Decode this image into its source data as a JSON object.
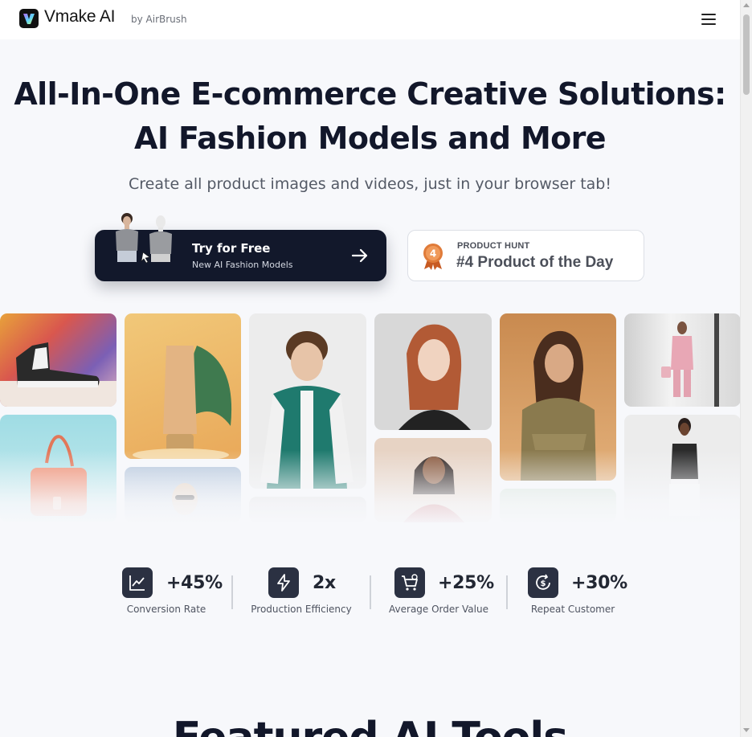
{
  "header": {
    "brand": "Vmake AI",
    "brand_suffix": "by AirBrush",
    "menu_icon": "hamburger-menu-icon"
  },
  "hero": {
    "title_line1": "All-In-One E-commerce Creative Solutions:",
    "title_line2": "AI Fashion Models and More",
    "subtitle": "Create all product images and videos, just in your browser tab!"
  },
  "cta": {
    "label": "Try for Free",
    "sublabel": "New AI Fashion Models",
    "icon": "arrow-right-icon"
  },
  "product_hunt": {
    "label": "PRODUCT HUNT",
    "rank_text": "#4 Product of the Day",
    "medal_number": "4",
    "icon": "medal-icon"
  },
  "gallery": {
    "items": [
      "sneaker",
      "skincare-tube",
      "model-varsity-jacket",
      "model-red-hair",
      "model-knit-cardigan",
      "model-pink-suit",
      "handbag",
      "model-sunglasses",
      "model-tank-top",
      "model-red-top"
    ]
  },
  "stats": [
    {
      "value": "+45%",
      "label": "Conversion Rate",
      "icon": "chart-line-icon"
    },
    {
      "value": "2x",
      "label": "Production Efficiency",
      "icon": "lightning-icon"
    },
    {
      "value": "+25%",
      "label": "Average Order Value",
      "icon": "cart-icon"
    },
    {
      "value": "+30%",
      "label": "Repeat Customer",
      "icon": "dollar-refresh-icon"
    }
  ],
  "section": {
    "title": "Featured AI Tools"
  },
  "colors": {
    "primary_dark": "#12182b",
    "page_bg": "#f7f8fb",
    "medal_orange": "#e07b39"
  }
}
